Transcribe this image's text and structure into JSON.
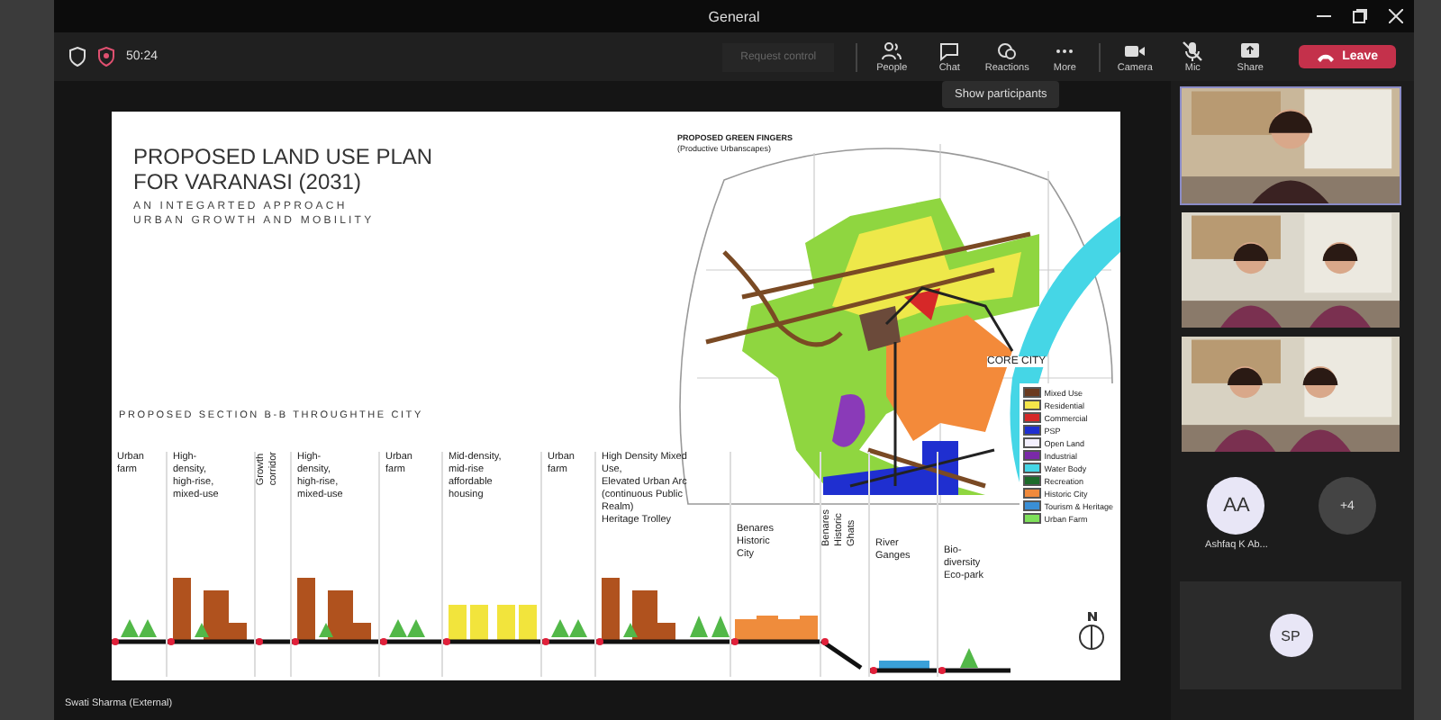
{
  "window": {
    "title": "General"
  },
  "meeting_bar": {
    "timer": "50:24",
    "request_control": {
      "label": "Request control",
      "disabled": true
    },
    "actions": [
      {
        "kind": "people",
        "label": "People",
        "off": false
      },
      {
        "kind": "chat",
        "label": "Chat",
        "off": false
      },
      {
        "kind": "reactions",
        "label": "Reactions",
        "off": false
      },
      {
        "kind": "more",
        "label": "More",
        "off": false
      },
      {
        "kind": "camera",
        "label": "Camera",
        "off": false
      },
      {
        "kind": "mic",
        "label": "Mic",
        "off": true
      },
      {
        "kind": "share",
        "label": "Share",
        "off": false
      }
    ],
    "leave": "Leave"
  },
  "tooltip": "Show participants",
  "slide": {
    "title_lines": [
      "PROPOSED LAND USE PLAN",
      "FOR VARANASI (2031)"
    ],
    "subtitle_lines": [
      "AN INTEGARTED APPROACH",
      "URBAN GROWTH AND MOBILITY"
    ],
    "map": {
      "title": "PROPOSED GREEN FINGERS",
      "subtitle": "(Productive Urbanscapes)",
      "label": "CORE CITY",
      "legend": [
        {
          "label": "Mixed Use",
          "color": "#6b3a1f"
        },
        {
          "label": "Residential",
          "color": "#f5e64a"
        },
        {
          "label": "Commercial",
          "color": "#d62828"
        },
        {
          "label": "PSP",
          "color": "#1f2fd0"
        },
        {
          "label": "Open Land",
          "color": "#f4f0ff"
        },
        {
          "label": "Industrial",
          "color": "#7a2aa8"
        },
        {
          "label": "Water Body",
          "color": "#45d6e6"
        },
        {
          "label": "Recreation",
          "color": "#1d6b2a"
        },
        {
          "label": "Historic City",
          "color": "#f08a3c"
        },
        {
          "label": "Tourism & Heritage",
          "color": "#3a8fd6"
        },
        {
          "label": "Urban Farm",
          "color": "#7ee05a"
        }
      ]
    },
    "section_title": "PROPOSED SECTION B-B THROUGHTHE CITY",
    "sections": [
      {
        "kind": "farm",
        "lines": [
          "Urban",
          "farm"
        ]
      },
      {
        "kind": "highrise",
        "lines": [
          "High-",
          "density,",
          "high-rise,",
          "mixed-use"
        ]
      },
      {
        "kind": "corridor",
        "lines": [
          "Growth",
          "corridor"
        ]
      },
      {
        "kind": "highrise",
        "lines": [
          "High-",
          "density,",
          "high-rise,",
          "mixed-use"
        ]
      },
      {
        "kind": "farm",
        "lines": [
          "Urban",
          "farm"
        ]
      },
      {
        "kind": "midrise",
        "lines": [
          "Mid-density,",
          "mid-rise",
          "affordable",
          "housing"
        ]
      },
      {
        "kind": "farm",
        "lines": [
          "Urban",
          "farm"
        ]
      },
      {
        "kind": "mixed",
        "lines": [
          "High Density Mixed",
          "Use,",
          "Elevated Urban Arc",
          "(continuous Public",
          "Realm)",
          "Heritage Trolley"
        ]
      },
      {
        "kind": "historic",
        "lines": [
          "Benares",
          "Historic",
          "City"
        ]
      },
      {
        "kind": "ghats",
        "lines": [
          "Benares",
          "Historic",
          "Ghats"
        ]
      },
      {
        "kind": "river",
        "lines": [
          "River",
          "Ganges"
        ]
      },
      {
        "kind": "park",
        "lines": [
          "Bio-",
          "diversity",
          "Eco-park"
        ]
      }
    ]
  },
  "presenter_label": "Swati Sharma (External)",
  "participants": {
    "videos": [
      {
        "speaking": true
      },
      {
        "speaking": false
      },
      {
        "speaking": false
      }
    ],
    "avatars": [
      {
        "kind": "person",
        "initials": "AA",
        "name": "Ashfaq K Ab..."
      },
      {
        "kind": "overflow",
        "initials": "+4"
      }
    ],
    "tile": {
      "initials": "SP"
    }
  }
}
